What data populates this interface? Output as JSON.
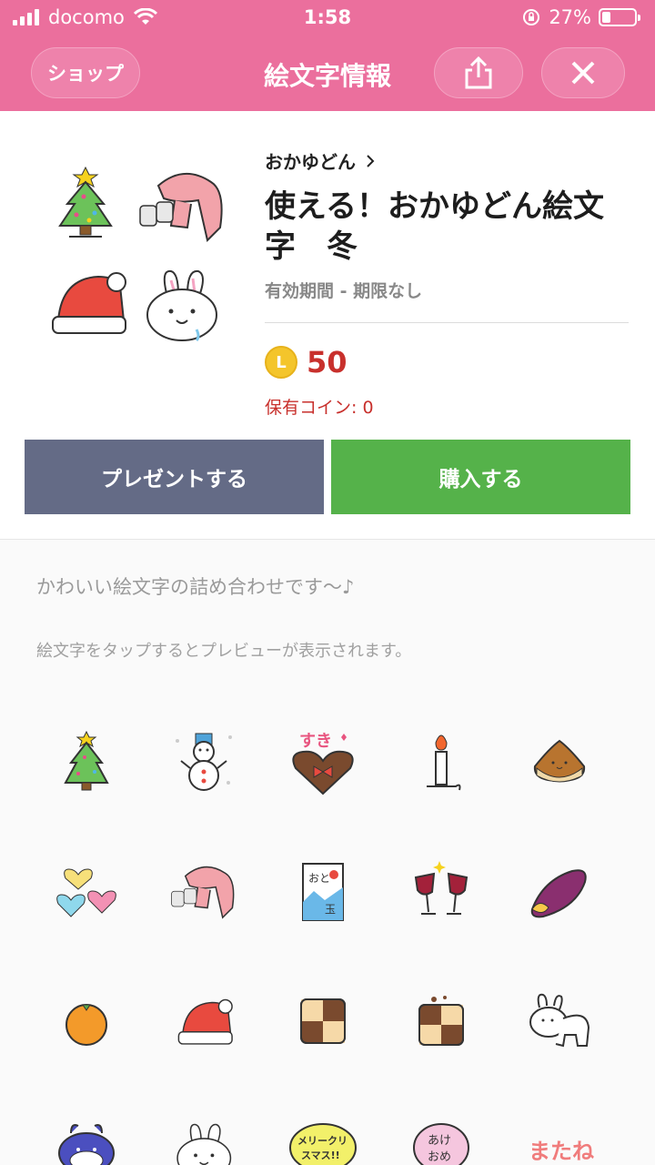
{
  "status": {
    "carrier": "docomo",
    "time": "1:58",
    "battery_text": "27%",
    "battery_level": 0.27
  },
  "header": {
    "shop_label": "ショップ",
    "title": "絵文字情報"
  },
  "product": {
    "author": "おかゆどん",
    "title": "使える！おかゆどん絵文字　冬",
    "validity": "有効期間 - 期限なし",
    "coin_symbol": "L",
    "price": "50",
    "owned": "保有コイン: 0"
  },
  "actions": {
    "present": "プレゼントする",
    "buy": "購入する"
  },
  "description": {
    "line1": "かわいい絵文字の詰め合わせです〜♪",
    "line2": "絵文字をタップするとプレビューが表示されます。"
  },
  "emoji_grid": {
    "items": [
      {
        "icon": "christmas-tree"
      },
      {
        "icon": "snowman"
      },
      {
        "icon": "heart-chocolate",
        "text": "すき"
      },
      {
        "icon": "candle"
      },
      {
        "icon": "chestnut"
      },
      {
        "icon": "hearts"
      },
      {
        "icon": "scarf-mittens"
      },
      {
        "icon": "otoshidama",
        "text1": "おと",
        "text2": "玉"
      },
      {
        "icon": "wine-toast"
      },
      {
        "icon": "sweet-potato"
      },
      {
        "icon": "mikan"
      },
      {
        "icon": "santa-hat"
      },
      {
        "icon": "checker-cookie"
      },
      {
        "icon": "checker-cookie-bitten"
      },
      {
        "icon": "rabbit-body"
      },
      {
        "icon": "blue-bear"
      },
      {
        "icon": "rabbit-face"
      },
      {
        "icon": "merry-christmas-bubble",
        "text1": "メリークリ",
        "text2": "スマス!!"
      },
      {
        "icon": "akeome-bubble",
        "text1": "あけ",
        "text2": "おめ"
      },
      {
        "icon": "matane-text",
        "text": "またね"
      }
    ]
  }
}
